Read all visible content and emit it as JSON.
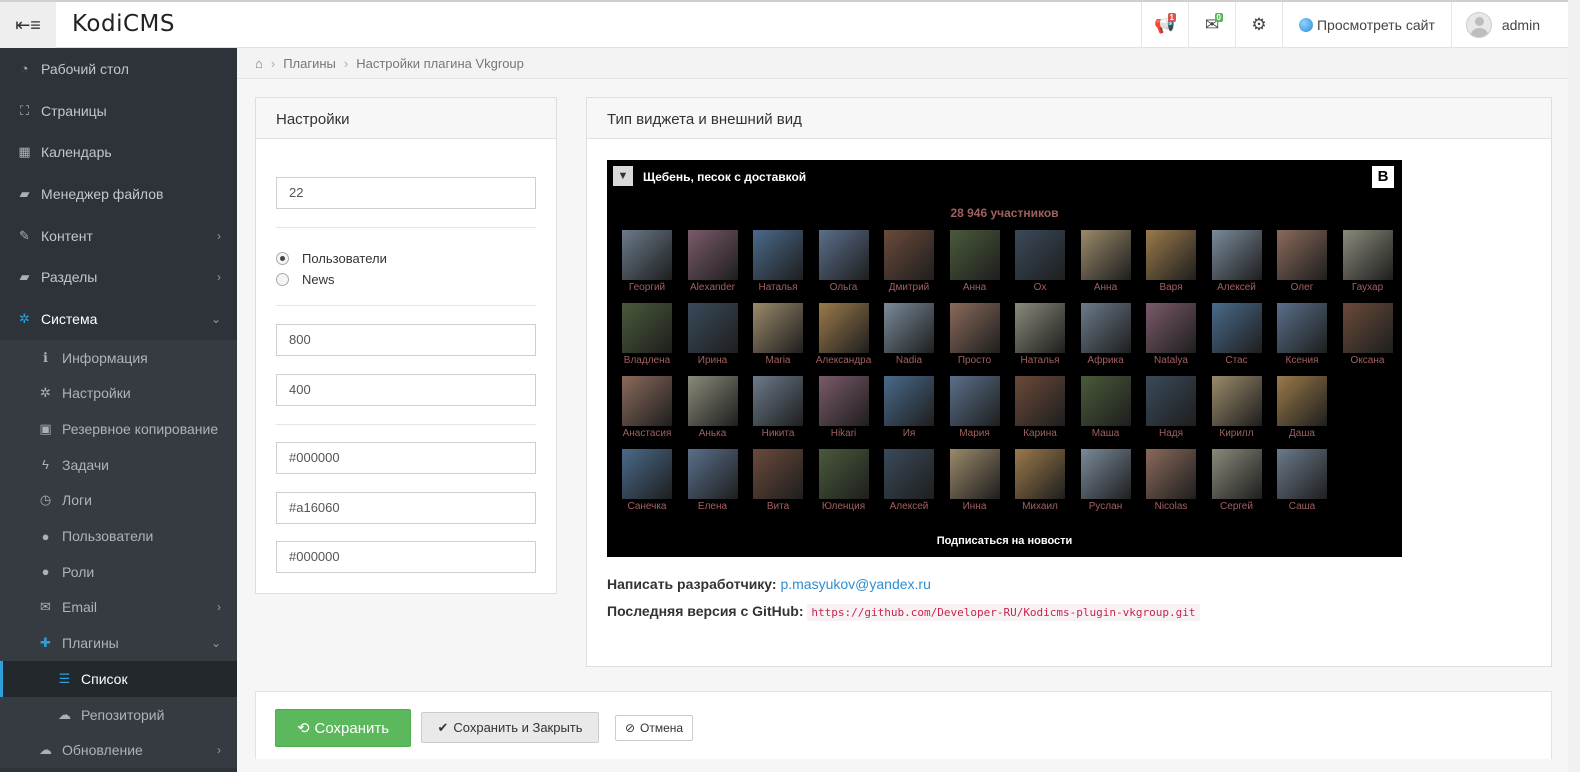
{
  "brand": "KodiCMS",
  "topnav": {
    "announce_badge": "1",
    "mail_badge": "0",
    "view_site": "Просмотреть сайт",
    "username": "admin"
  },
  "sidebar": {
    "items": [
      {
        "label": "Рабочий стол",
        "icon": "dashboard-icon",
        "glyph": "◔"
      },
      {
        "label": "Страницы",
        "icon": "sitemap-icon",
        "glyph": "⛶"
      },
      {
        "label": "Календарь",
        "icon": "calendar-icon",
        "glyph": "▦"
      },
      {
        "label": "Менеджер файлов",
        "icon": "folder-icon",
        "glyph": "▰"
      },
      {
        "label": "Контент",
        "icon": "edit-icon",
        "glyph": "✎"
      },
      {
        "label": "Разделы",
        "icon": "folder-icon",
        "glyph": "▰"
      },
      {
        "label": "Система",
        "icon": "cog-icon",
        "glyph": "✲"
      }
    ],
    "system_sub": [
      {
        "label": "Информация",
        "icon": "info-icon",
        "glyph": "ℹ"
      },
      {
        "label": "Настройки",
        "icon": "cog-icon",
        "glyph": "✲"
      },
      {
        "label": "Резервное копирование",
        "icon": "backup-icon",
        "glyph": "▣"
      },
      {
        "label": "Задачи",
        "icon": "bolt-icon",
        "glyph": "ϟ"
      },
      {
        "label": "Логи",
        "icon": "clock-icon",
        "glyph": "◷"
      },
      {
        "label": "Пользователи",
        "icon": "user-icon",
        "glyph": "●"
      },
      {
        "label": "Роли",
        "icon": "users-icon",
        "glyph": "●"
      },
      {
        "label": "Email",
        "icon": "envelope-icon",
        "glyph": "✉"
      },
      {
        "label": "Плагины",
        "icon": "puzzle-icon",
        "glyph": "✚"
      }
    ],
    "plugins_sub": [
      {
        "label": "Список",
        "icon": "list-icon",
        "glyph": "☰"
      },
      {
        "label": "Репозиторий",
        "icon": "cloud-icon",
        "glyph": "☁"
      }
    ],
    "update": {
      "label": "Обновление",
      "icon": "cloud-download-icon",
      "glyph": "☁"
    }
  },
  "breadcrumb": {
    "items": [
      "Плагины",
      "Настройки плагина Vkgroup"
    ]
  },
  "settings": {
    "title": "Настройки",
    "group_id": "22",
    "radio_users": "Пользователи",
    "radio_news": "News",
    "width": "800",
    "height": "400",
    "color1": "#000000",
    "color2": "#a16060",
    "color3": "#000000"
  },
  "preview": {
    "title": "Тип виджета и внешний вид",
    "group_name": "Щебень, песок с доставкой",
    "vk_logo": "B",
    "members_count": "28 946 участников",
    "subscribe": "Подписаться на новости",
    "members": [
      "Георгий",
      "Alexander",
      "Наталья",
      "Ольга",
      "Дмитрий",
      "Анна",
      "Ох",
      "Анна",
      "Варя",
      "Алексей",
      "Олег",
      "Гаухар",
      "Владлена",
      "Ирина",
      "Maria",
      "Александра",
      "Nadia",
      "Просто",
      "Наталья",
      "Африка",
      "Natalya",
      "Стас",
      "Ксения",
      "Оксана",
      "Анастасия",
      "Анька",
      "Никита",
      "Hikari",
      "Ия",
      "Мария",
      "Карина",
      "Маша",
      "Надя",
      "Кирилл",
      "Даша",
      "Санечка",
      "Елена",
      "Вита",
      "Юленция",
      "Алексей",
      "Инна",
      "Михаил",
      "Руслан",
      "Nicolas",
      "Сергей",
      "Саша"
    ],
    "colors": {
      "bg": "#000000",
      "text": "#a16060"
    }
  },
  "info": {
    "dev_label": "Написать разработчику:",
    "dev_email": "p.masyukov@yandex.ru",
    "github_label": "Последняя версия с GitHub:",
    "github_url": "https://github.com/Developer-RU/Kodicms-plugin-vkgroup.git"
  },
  "actions": {
    "save": "Сохранить",
    "save_close": "Сохранить и Закрыть",
    "cancel": "Отмена"
  }
}
